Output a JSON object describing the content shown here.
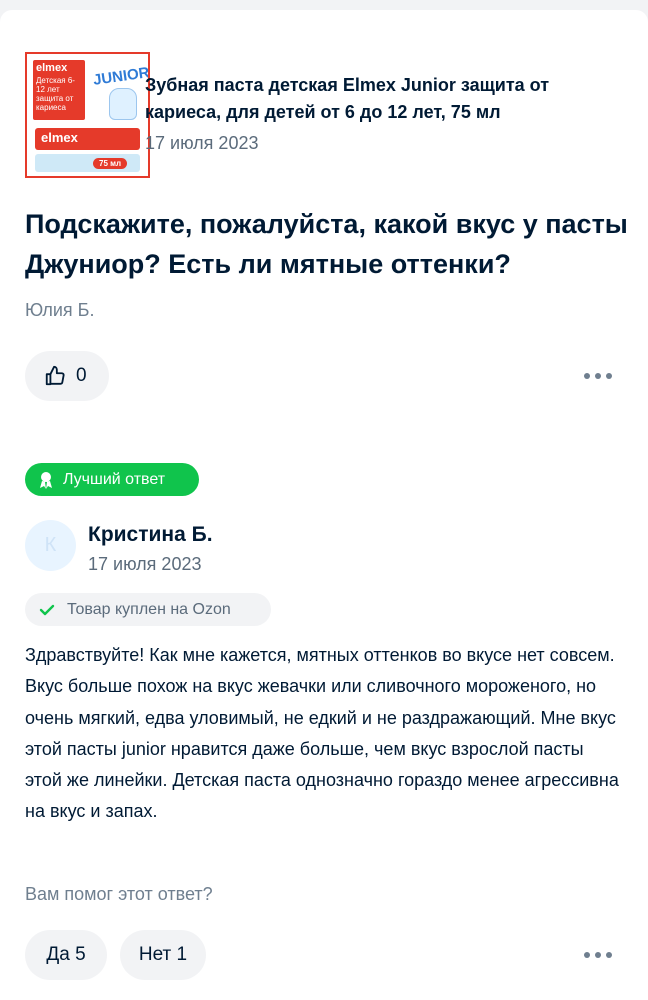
{
  "product": {
    "title": "Зубная паста детская Elmex Junior защита от кариеса, для детей от 6 до 12 лет, 75 мл",
    "date": "17 июля 2023",
    "thumbnail": {
      "brand": "elmex",
      "age_text": "Детская 6-12 лет защита от кариеса",
      "junior": "JUNIOR",
      "volume": "75 мл"
    }
  },
  "question": {
    "text": "Подскажите, пожалуйста, какой вкус у пасты Джуниор? Есть ли мятные оттенки?",
    "author": "Юлия Б.",
    "likes": "0"
  },
  "answer": {
    "badge": "Лучший ответ",
    "avatar_letter": "К",
    "author": "Кристина Б.",
    "date": "17 июля 2023",
    "purchased": "Товар куплен на Ozon",
    "text": "Здравствуйте! Как мне кажется, мятных оттенков во вкусе нет совсем. Вкус больше похож на вкус жевачки или сливочного мороженого, но очень мягкий, едва уловимый, не едкий и не раздражающий. Мне вкус этой пасты junior нравится даже больше, чем вкус взрослой пасты этой же линейки. Детская паста однозначно гораздо менее агрессивна на вкус и запах.",
    "helpful_question": "Вам помог этот ответ?",
    "yes": "Да 5",
    "no": "Нет 1"
  },
  "colors": {
    "text": "#001a34",
    "secondary": "#5b6b7b",
    "pill_bg": "#f2f3f5",
    "best_badge": "#10c44c",
    "brand_red": "#e53a2a"
  },
  "icons": [
    "thumbs-up-icon",
    "more-icon",
    "award-icon",
    "check-icon"
  ]
}
